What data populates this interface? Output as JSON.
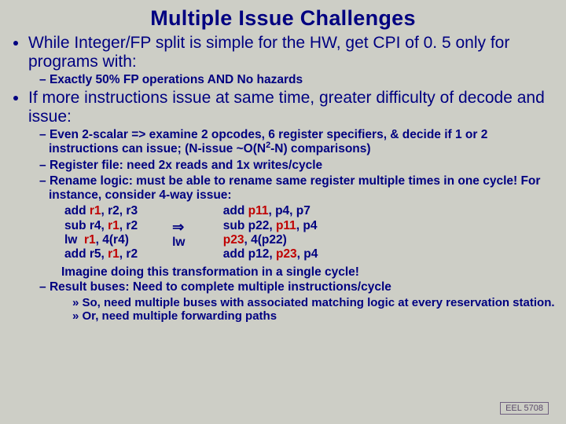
{
  "title": "Multiple Issue Challenges",
  "bullets": {
    "b1": "While Integer/FP split is simple for the HW, get CPI of 0. 5 only for programs with:",
    "b1_s1": "Exactly 50% FP operations AND No hazards",
    "b2": "If more instructions issue at same time, greater difficulty of decode and issue:",
    "b2_s1_a": "Even 2-scalar => examine 2 opcodes, 6 register specifiers, & decide if 1 or 2 instructions can issue; (N-issue ~O(N",
    "b2_s1_b": "-N) comparisons)",
    "b2_s2": "Register file: need 2x reads and 1x writes/cycle",
    "b2_s3": "Rename logic: must be able to rename same register multiple times in one cycle!  For instance, consider 4-way issue:",
    "imagine": "Imagine doing this transformation in a single cycle!",
    "b2_s4": "Result buses: Need to complete multiple instructions/cycle",
    "b2_s4_a": "So, need multiple buses with associated matching logic at every reservation station.",
    "b2_s4_b": "Or, need multiple forwarding paths"
  },
  "code": {
    "left": {
      "l1a": "add ",
      "l1r": "r1",
      "l1b": ", r2, r3",
      "l2a": "sub r4, ",
      "l2r": "r1",
      "l2b": ", r2",
      "l3a": "lw  ",
      "l3r": "r1",
      "l3b": ", 4(r4)",
      "l4a": "add r5, ",
      "l4r": "r1",
      "l4b": ", r2"
    },
    "mid": {
      "blank": " ",
      "arrow": "⇒",
      "lw": "lw"
    },
    "right": {
      "r1a": " add ",
      "r1p": "p11",
      "r1b": ", p4, p7",
      "r2a": " sub p22, ",
      "r2p": "p11",
      "r2b": ", p4",
      "r3p": "p23",
      "r3b": ", 4(p22)",
      "r4a": " add p12, ",
      "r4p": "p23",
      "r4b": ", p4"
    }
  },
  "footer": "EEL 5708"
}
